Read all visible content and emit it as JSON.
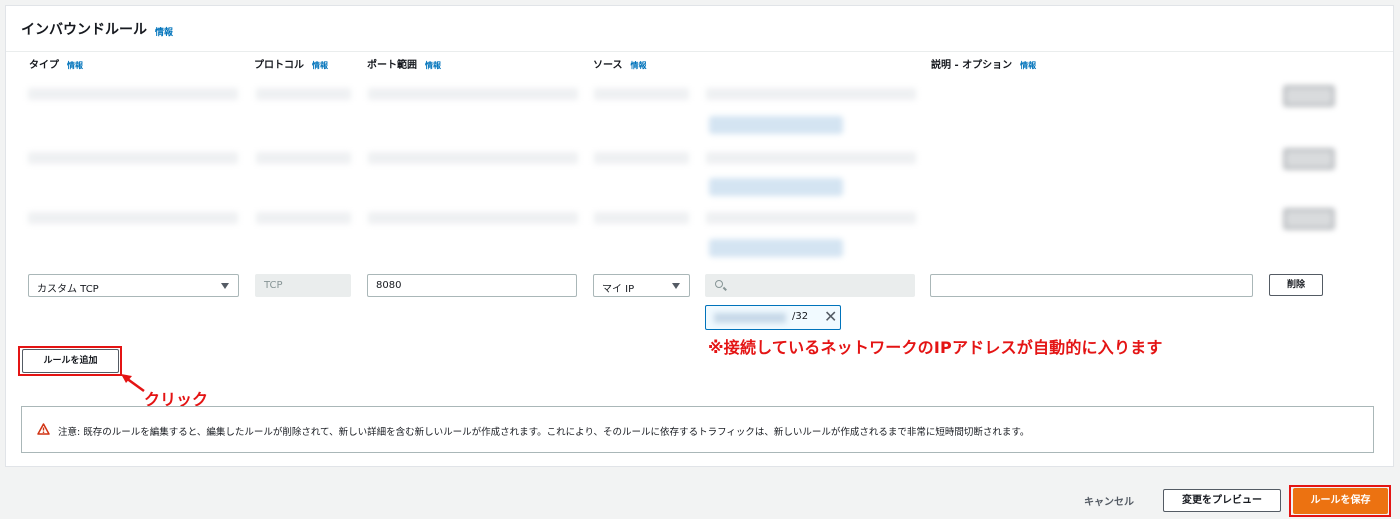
{
  "panel": {
    "title": "インバウンドルール",
    "info": "情報"
  },
  "columns": {
    "type": "タイプ",
    "protocol": "プロトコル",
    "port_range": "ポート範囲",
    "source": "ソース",
    "description": "説明 - オプション",
    "info": "情報"
  },
  "new_rule": {
    "type_value": "カスタム TCP",
    "protocol_value": "TCP",
    "port_value": "8080",
    "source_value": "マイ IP",
    "search_placeholder": "",
    "cidr_suffix": "/32",
    "description_value": "",
    "delete_label": "削除"
  },
  "add_rule_label": "ルールを追加",
  "annotations": {
    "ip_note": "※接続しているネットワークのIPアドレスが自動的に入ります",
    "click_label": "クリック"
  },
  "warning": {
    "text": "注意: 既存のルールを編集すると、編集したルールが削除されて、新しい詳細を含む新しいルールが作成されます。これにより、そのルールに依存するトラフィックは、新しいルールが作成されるまで非常に短時間切断されます。"
  },
  "footer": {
    "cancel_label": "キャンセル",
    "preview_label": "変更をプレビュー",
    "save_label": "ルールを保存"
  },
  "colors": {
    "accent": "#ec7211",
    "link": "#0073bb",
    "annotation_red": "#e41414",
    "warning_red": "#d13212"
  },
  "icons": {
    "select_caret": "caret-down-icon",
    "search": "search-icon",
    "remove_token": "close-icon",
    "warning": "warning-icon",
    "annotation_arrow": "arrow-icon"
  }
}
